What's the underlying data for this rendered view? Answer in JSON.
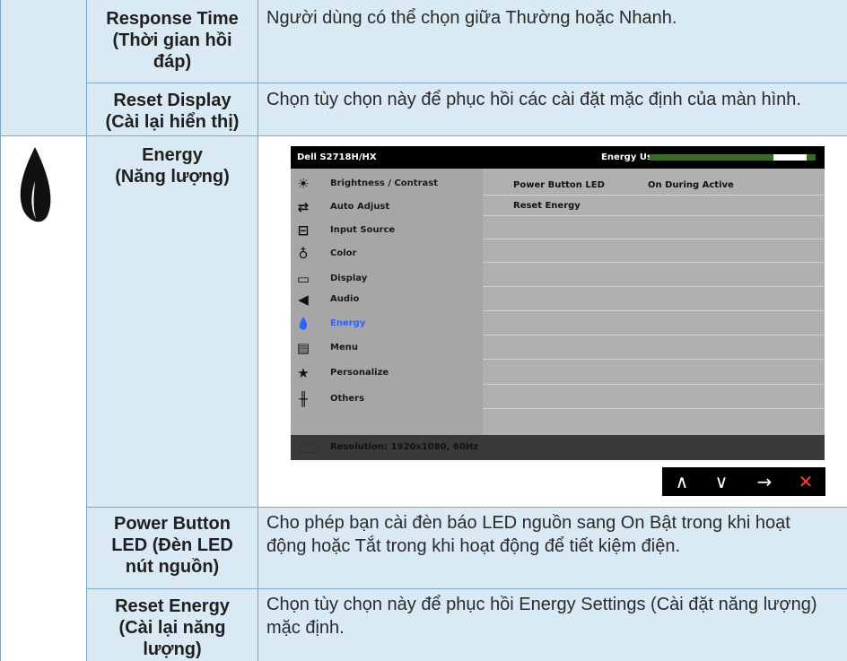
{
  "rows": [
    {
      "label": "Response Time\n(Thời gian hồi\nđáp)",
      "desc": "Người dùng có thể chọn giữa Thường hoặc Nhanh."
    },
    {
      "label": "Reset Display\n(Cài lại hiển thị)",
      "desc": "Chọn tùy chọn này để phục hồi các cài đặt mặc định của màn hình."
    },
    {
      "label": "Energy\n(Năng lượng)",
      "desc": ""
    },
    {
      "label": "Power Button\nLED (Đèn LED\nnút nguồn)",
      "desc": "Cho phép bạn cài đèn báo LED nguồn sang On Bật trong khi hoạt động hoặc Tắt trong khi hoạt động để tiết kiệm điện."
    },
    {
      "label": "Reset Energy\n(Cài lại năng\nlượng)",
      "desc": "Chọn tùy chọn này để phục hồi Energy Settings (Cài đặt năng lượng) mặc định."
    }
  ],
  "osd": {
    "model": "Dell S2718H/HX",
    "energy_use_label": "Energy Use",
    "energy_use_level": 0.8,
    "menu": [
      {
        "label": "Brightness / Contrast",
        "icon": "brightness-icon"
      },
      {
        "label": "Auto Adjust",
        "icon": "auto-adjust-icon"
      },
      {
        "label": "Input Source",
        "icon": "input-source-icon"
      },
      {
        "label": "Color",
        "icon": "color-icon"
      },
      {
        "label": "Display",
        "icon": "display-icon"
      },
      {
        "label": "Audio",
        "icon": "audio-icon"
      },
      {
        "label": "Energy",
        "icon": "energy-drop-icon",
        "active": true
      },
      {
        "label": "Menu",
        "icon": "menu-icon"
      },
      {
        "label": "Personalize",
        "icon": "star-icon"
      },
      {
        "label": "Others",
        "icon": "others-icon"
      }
    ],
    "submenu": [
      {
        "key": "Power Button LED",
        "value": "On During Active"
      },
      {
        "key": "Reset Energy",
        "value": ""
      }
    ],
    "resolution": "Resolution: 1920x1080, 60Hz",
    "nav": {
      "up": "∧",
      "down": "∨",
      "enter": "→",
      "close": "✕"
    }
  }
}
